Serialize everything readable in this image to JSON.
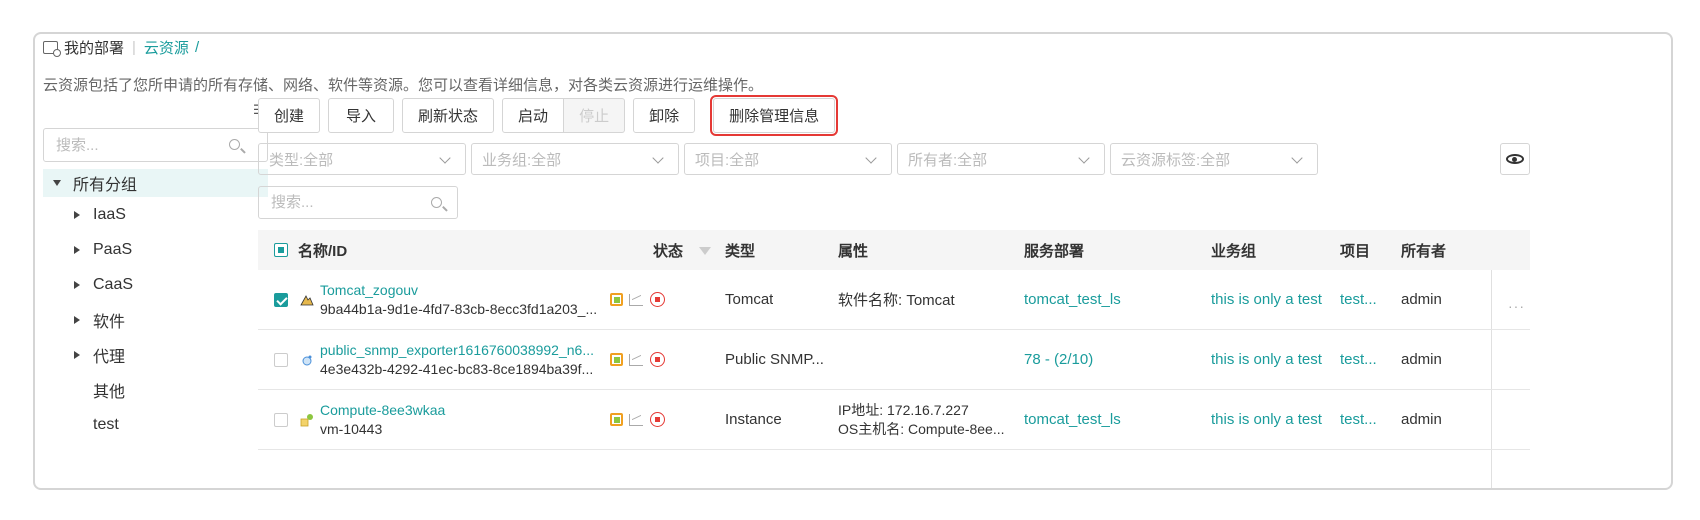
{
  "breadcrumb": {
    "root": "我的部署",
    "current": "云资源",
    "slash": "/"
  },
  "description": "云资源包括了您所申请的所有存储、网络、软件等资源。您可以查看详细信息，对各类云资源进行运维操作。",
  "sidebar": {
    "search_placeholder": "搜索...",
    "root_label": "所有分组",
    "items": [
      {
        "label": "IaaS",
        "expandable": true
      },
      {
        "label": "PaaS",
        "expandable": true
      },
      {
        "label": "CaaS",
        "expandable": true
      },
      {
        "label": "软件",
        "expandable": true
      },
      {
        "label": "代理",
        "expandable": true
      },
      {
        "label": "其他",
        "expandable": false
      },
      {
        "label": "test",
        "expandable": false
      }
    ]
  },
  "toolbar": {
    "create": "创建",
    "import": "导入",
    "refresh": "刷新状态",
    "start": "启动",
    "stop": "停止",
    "uninstall": "卸除",
    "delete_mgmt": "删除管理信息"
  },
  "filters": {
    "type": "类型:全部",
    "business_group": "业务组:全部",
    "project": "项目:全部",
    "owner": "所有者:全部",
    "tag": "云资源标签:全部"
  },
  "table_search_placeholder": "搜索...",
  "table": {
    "headers": {
      "name": "名称/ID",
      "status": "状态",
      "type": "类型",
      "attributes": "属性",
      "deployment": "服务部署",
      "business_group": "业务组",
      "project": "项目",
      "owner": "所有者"
    },
    "rows": [
      {
        "checked": true,
        "name": "Tomcat_zogouv",
        "id": "9ba44b1a-9d1e-4fd7-83cb-8ecc3fd1a203_...",
        "type": "Tomcat",
        "attr1": "软件名称: Tomcat",
        "attr2": "",
        "deployment": "tomcat_test_ls",
        "business_group": "this is only a test",
        "project": "test...",
        "owner": "admin",
        "more": "···"
      },
      {
        "checked": false,
        "name": "public_snmp_exporter1616760038992_n6...",
        "id": "4e3e432b-4292-41ec-bc83-8ce1894ba39f...",
        "type": "Public SNMP...",
        "attr1": "",
        "attr2": "",
        "deployment": "78 - (2/10)",
        "business_group": "this is only a test",
        "project": "test...",
        "owner": "admin",
        "more": ""
      },
      {
        "checked": false,
        "name": "Compute-8ee3wkaa",
        "id": "vm-10443",
        "type": "Instance",
        "attr1": "IP地址: 172.16.7.227",
        "attr2": "OS主机名: Compute-8ee...",
        "deployment": "tomcat_test_ls",
        "business_group": "this is only a test",
        "project": "test...",
        "owner": "admin",
        "more": ""
      }
    ]
  }
}
